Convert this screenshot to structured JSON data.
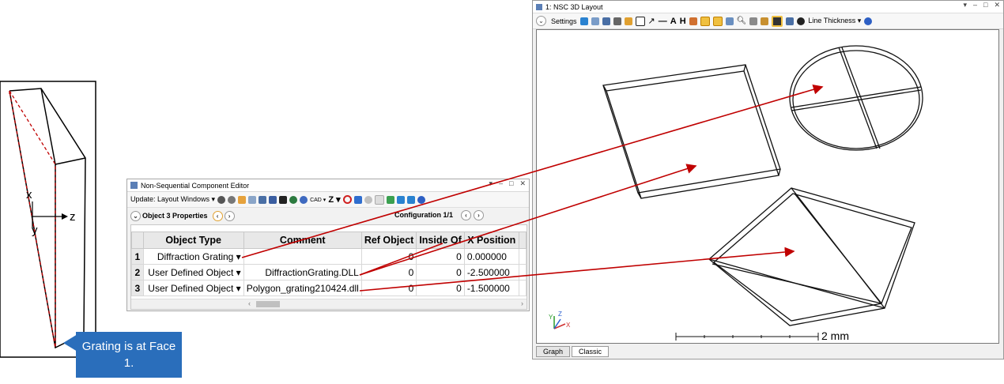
{
  "diagram": {
    "axis_x": "x",
    "axis_y": "y",
    "axis_z": "z",
    "callout": "Grating is at Face 1."
  },
  "editor": {
    "title": "Non-Sequential Component Editor",
    "toolbar_update": "Update: Layout Windows ▾",
    "toolbar_cad": "CAD ▾",
    "toolbar_z": "Z ▾",
    "nav_object": "Object  3 Properties",
    "nav_config": "Configuration 1/1",
    "columns": [
      "Object Type",
      "Comment",
      "Ref Object",
      "Inside Of",
      "X Position"
    ],
    "rows": [
      {
        "num": "1",
        "type": "Diffraction Grating ▾",
        "comment": "",
        "ref": "0",
        "inside": "0",
        "xpos": "0.000000"
      },
      {
        "num": "2",
        "type": "User Defined Object ▾",
        "comment": "DiffractionGrating.DLL",
        "ref": "0",
        "inside": "0",
        "xpos": "-2.500000"
      },
      {
        "num": "3",
        "type": "User Defined Object ▾",
        "comment": "Polygon_grating210424.dll",
        "ref": "0",
        "inside": "0",
        "xpos": "-1.500000"
      }
    ]
  },
  "layout": {
    "title": "1: NSC 3D Layout",
    "settings": "Settings",
    "line_thickness": "Line Thickness ▾",
    "scale": "2 mm",
    "tabs": [
      "Graph",
      "Classic"
    ],
    "triad_x": "X",
    "triad_y": "Y",
    "triad_z": "Z"
  },
  "colors": {
    "arrow": "#c00000",
    "callout": "#2a6ebb",
    "dashed_face": "#c00000"
  }
}
